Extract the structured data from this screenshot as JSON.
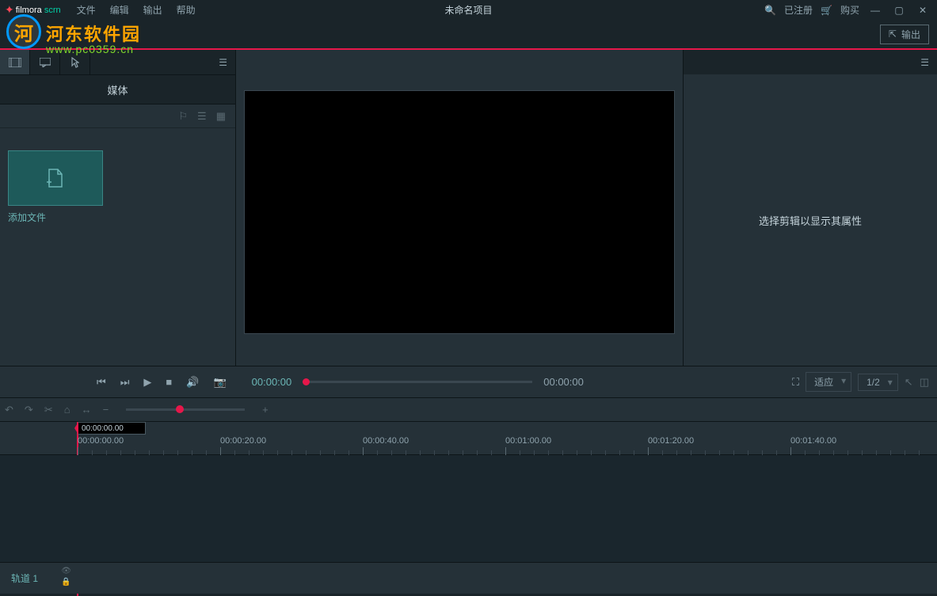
{
  "titlebar": {
    "logo_main": "filmora",
    "logo_sub": "scrn",
    "menu": [
      "文件",
      "编辑",
      "输出",
      "帮助"
    ],
    "project_title": "未命名项目",
    "registered": "已注册",
    "buy": "购买"
  },
  "watermark": {
    "char": "河",
    "text": "河东软件园",
    "url": "www.pc0359.cn"
  },
  "secondbar": {
    "export": "输出"
  },
  "left": {
    "tab": "媒体",
    "add_file": "添加文件"
  },
  "right": {
    "placeholder": "选择剪辑以显示其属性"
  },
  "controls": {
    "time_left": "00:00:00",
    "time_right": "00:00:00",
    "fit": "适应",
    "scale": "1/2"
  },
  "timeline": {
    "playhead": "00:00:00.00",
    "ticks": [
      "00:00:00.00",
      "00:00:20.00",
      "00:00:40.00",
      "00:01:00.00",
      "00:01:20.00",
      "00:01:40.00"
    ],
    "track1": "轨道 1"
  }
}
